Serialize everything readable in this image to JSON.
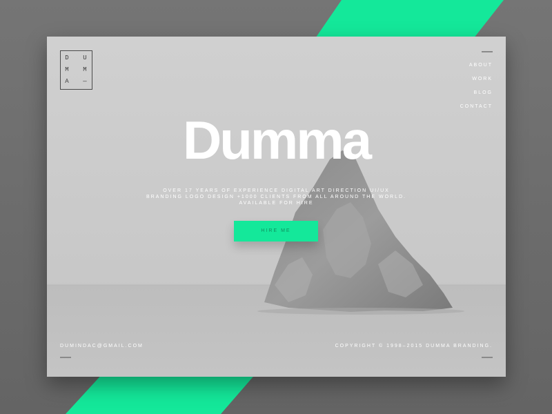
{
  "brand": {
    "logo_letters": [
      "D",
      "U",
      "M",
      "M",
      "A"
    ],
    "logo_dash": "—"
  },
  "nav": {
    "items": [
      {
        "label": "ABOUT"
      },
      {
        "label": "WORK"
      },
      {
        "label": "BLOG"
      },
      {
        "label": "CONTACT"
      }
    ]
  },
  "hero": {
    "title": "Dumma",
    "subtitle_lines": [
      "OVER 17 YEARS OF EXPERIENCE DIGITAL ART DIRECTION UI/UX",
      "BRANDING LOGO DESIGN +1000 CLIENTS FROM ALL AROUND THE WORLD.",
      "AVAILABLE FOR HIRE"
    ],
    "cta_label": "HIRE ME"
  },
  "footer": {
    "email": "DUMINDAC@GMAIL.COM",
    "copyright": "COPYRIGHT © 1998–2015 DUMMA BRANDING."
  },
  "colors": {
    "accent": "#14e89a",
    "background": "#6b6b6b",
    "card": "#c9c9c9",
    "text": "#ffffff"
  },
  "icons": {
    "logo": "dumma-monogram-icon",
    "nav_line": "divider-line-icon",
    "footer_line": "divider-line-icon"
  }
}
